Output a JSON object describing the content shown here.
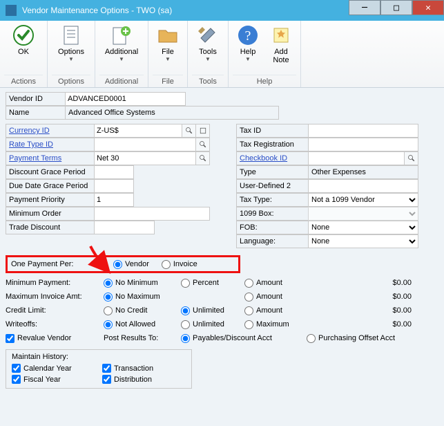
{
  "window": {
    "title": "Vendor Maintenance Options  -  TWO (sa)"
  },
  "ribbon": {
    "ok": "OK",
    "options": "Options",
    "additional": "Additional",
    "file": "File",
    "tools": "Tools",
    "help": "Help",
    "add_note": "Add\nNote",
    "grp_actions": "Actions",
    "grp_options": "Options",
    "grp_additional": "Additional",
    "grp_file": "File",
    "grp_tools": "Tools",
    "grp_help": "Help"
  },
  "header": {
    "vendor_id_lbl": "Vendor ID",
    "vendor_id_val": "ADVANCED0001",
    "name_lbl": "Name",
    "name_val": "Advanced Office Systems"
  },
  "left": {
    "currency_id_lbl": "Currency ID",
    "currency_id_val": "Z-US$",
    "rate_type_lbl": "Rate Type ID",
    "rate_type_val": "",
    "payment_terms_lbl": "Payment Terms",
    "payment_terms_val": "Net 30",
    "disc_grace_lbl": "Discount Grace Period",
    "disc_grace_val": "",
    "due_date_grace_lbl": "Due Date Grace Period",
    "due_date_grace_val": "",
    "pay_priority_lbl": "Payment Priority",
    "pay_priority_val": "1",
    "min_order_lbl": "Minimum Order",
    "min_order_val": "",
    "trade_disc_lbl": "Trade Discount",
    "trade_disc_val": ""
  },
  "right": {
    "tax_id_lbl": "Tax ID",
    "tax_id_val": "",
    "tax_reg_lbl": "Tax Registration",
    "tax_reg_val": "",
    "checkbook_lbl": "Checkbook ID",
    "checkbook_val": "",
    "type_lbl": "Type",
    "type_val": "Other Expenses",
    "ud2_lbl": "User-Defined 2",
    "ud2_val": "",
    "tax_type_lbl": "Tax Type:",
    "tax_type_val": "Not a 1099 Vendor",
    "box1099_lbl": "1099 Box:",
    "box1099_val": "",
    "fob_lbl": "FOB:",
    "fob_val": "None",
    "lang_lbl": "Language:",
    "lang_val": "None"
  },
  "onepay": {
    "legend": "One Payment Per:",
    "vendor": "Vendor",
    "invoice": "Invoice"
  },
  "limits": {
    "min_pay_lbl": "Minimum Payment:",
    "nomin": "No Minimum",
    "percent": "Percent",
    "amount": "Amount",
    "zero": "$0.00",
    "max_inv_lbl": "Maximum Invoice Amt:",
    "nomax": "No Maximum",
    "credit_lbl": "Credit Limit:",
    "nocredit": "No Credit",
    "unlimited": "Unlimited",
    "writeoff_lbl": "Writeoffs:",
    "notallowed": "Not Allowed",
    "maximum": "Maximum",
    "revalue": "Revalue Vendor",
    "post_to": "Post Results To:",
    "payables_acct": "Payables/Discount Acct",
    "purchase_acct": "Purchasing Offset Acct"
  },
  "history": {
    "legend": "Maintain History:",
    "calendar": "Calendar Year",
    "fiscal": "Fiscal Year",
    "transaction": "Transaction",
    "distribution": "Distribution"
  }
}
